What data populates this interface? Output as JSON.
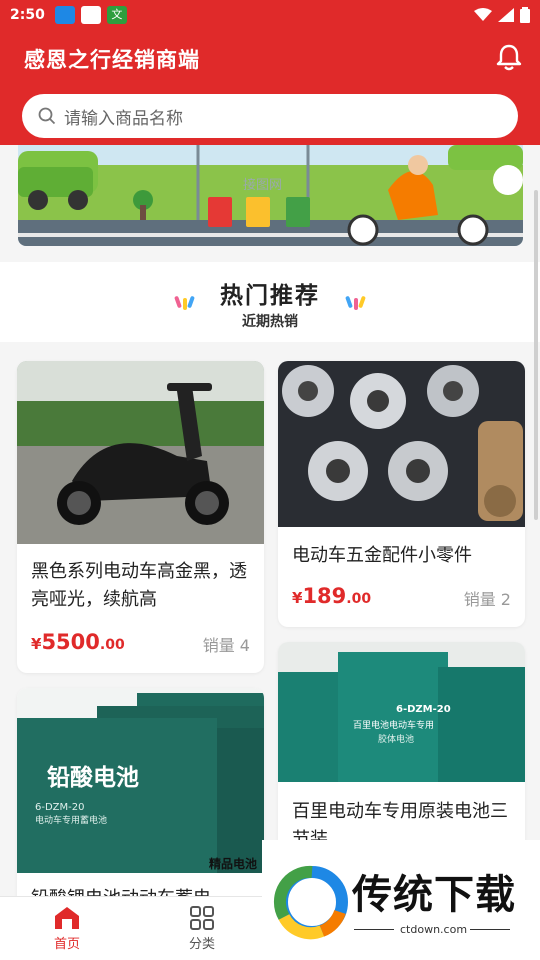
{
  "status_bar": {
    "time": "2:50",
    "app_icon_badge": "文"
  },
  "header": {
    "title": "感恩之行经销商端",
    "bell_icon": "bell-icon"
  },
  "search": {
    "placeholder": "请输入商品名称"
  },
  "banner": {
    "watermark": "接图网"
  },
  "section": {
    "title": "热门推荐",
    "subtitle": "近期热销"
  },
  "products": [
    {
      "name": "黑色系列电动车高金黑，透亮哑光，续航高",
      "price_symbol": "¥",
      "price_int": "5500",
      "price_dec": ".00",
      "sales": "销量 4"
    },
    {
      "name": "电动车五金配件小零件",
      "price_symbol": "¥",
      "price_int": "189",
      "price_dec": ".00",
      "sales": "销量 2"
    },
    {
      "name": "铅酸锂电池动动车蓄电",
      "image_text_1": "铅酸电池",
      "image_text_2": "6-DZM-20",
      "image_text_3": "电动车专用蓄电池",
      "image_text_4": "精品电池"
    },
    {
      "name": "百里电动车专用原装电池三节装",
      "image_text_1": "6-DZM-20",
      "image_text_2": "百里电池电动车专用",
      "image_text_3": "胶体电池"
    }
  ],
  "bottom_nav": [
    {
      "label": "首页",
      "icon": "home-icon",
      "active": true
    },
    {
      "label": "分类",
      "icon": "grid-icon",
      "active": false
    }
  ],
  "watermark": {
    "text": "传统下载",
    "url": "ctdown.com"
  },
  "colors": {
    "primary": "#e02a2a",
    "price": "#e02a2a",
    "sales": "#999999"
  }
}
